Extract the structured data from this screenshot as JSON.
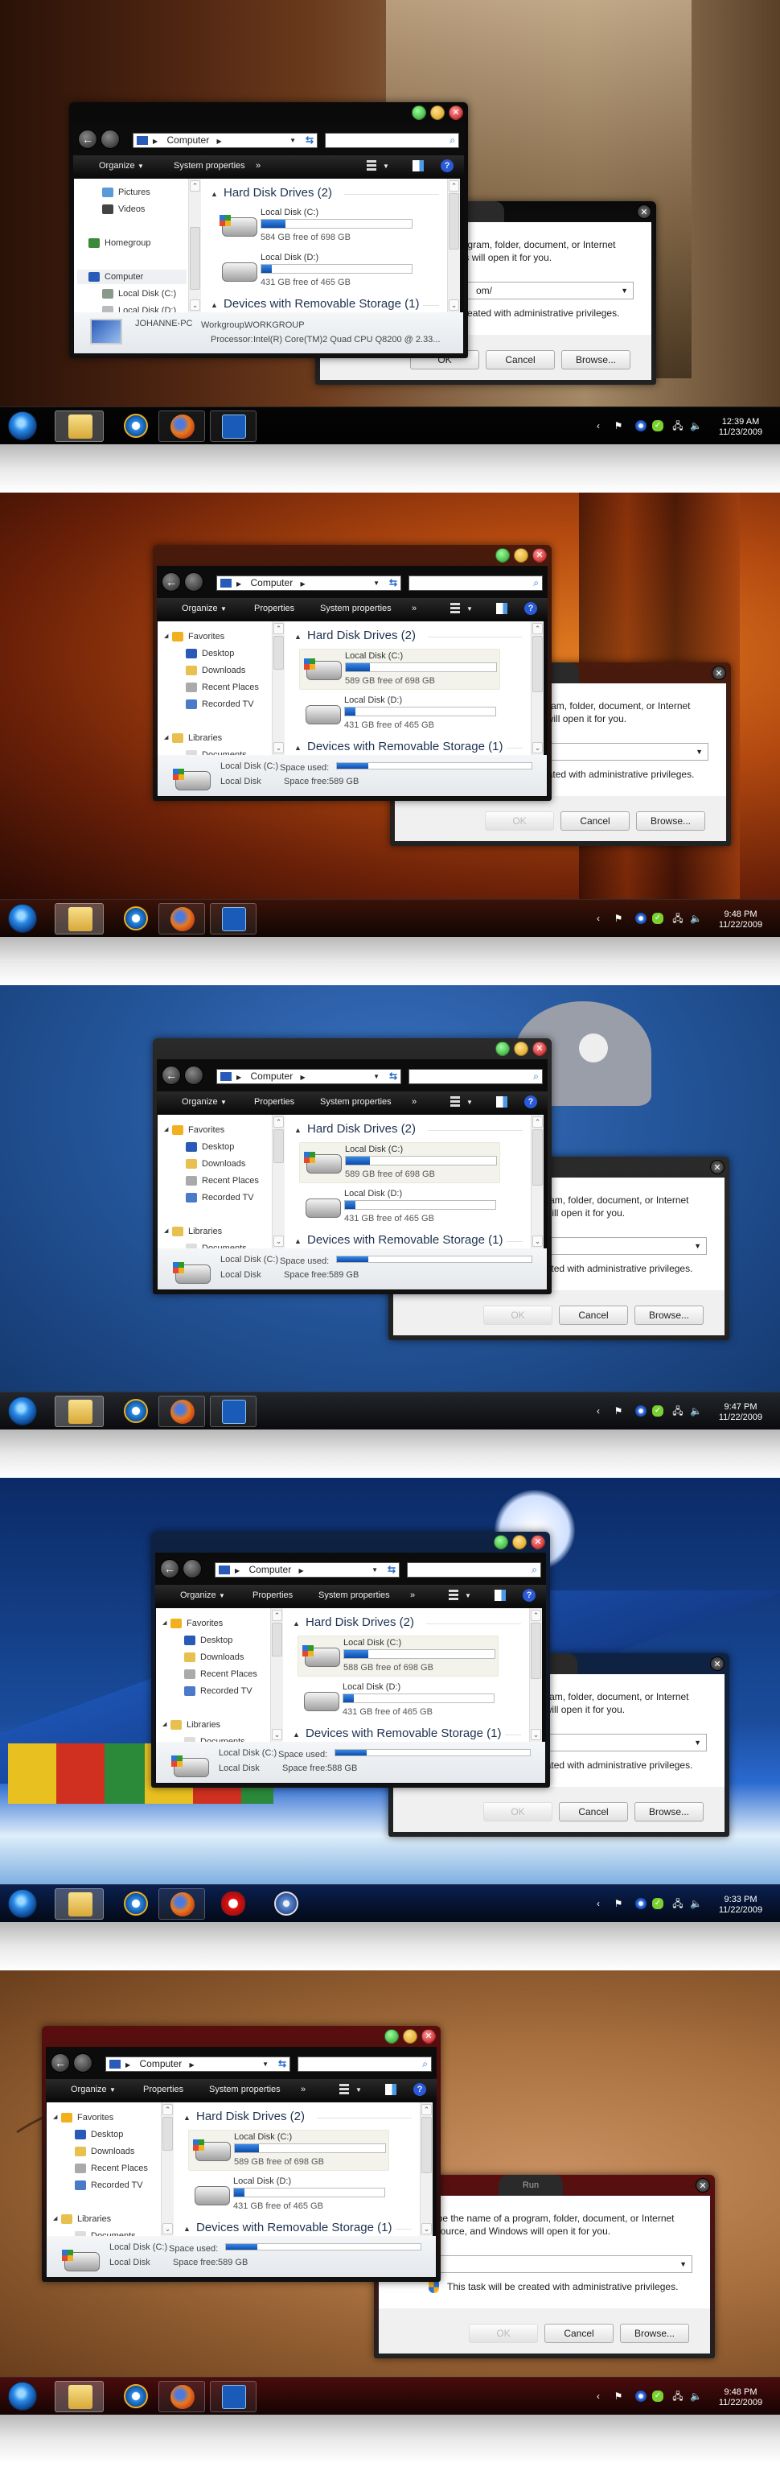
{
  "panels": [
    {
      "theme": {
        "frame": "#0a0a0a",
        "taskbar": "#050505"
      },
      "explorer": {
        "address": "Computer",
        "commands": [
          "Organize",
          "System properties",
          "»"
        ],
        "nav": [
          {
            "label": "Pictures",
            "icon": "pictures-icon",
            "indent": 1
          },
          {
            "label": "Videos",
            "icon": "videos-icon",
            "indent": 1
          },
          {
            "label": "Homegroup",
            "icon": "homegroup-icon",
            "indent": 0
          },
          {
            "label": "Computer",
            "icon": "computer-icon",
            "indent": 0,
            "selected": true
          },
          {
            "label": "Local Disk (C:)",
            "icon": "drive-c-icon",
            "indent": 1
          },
          {
            "label": "Local Disk (D:)",
            "icon": "drive-d-icon",
            "indent": 1
          }
        ],
        "nav_tops": [
          8,
          29,
          71,
          113,
          134,
          155
        ],
        "sections": {
          "hdd": "Hard Disk Drives (2)",
          "removable": "Devices with Removable Storage (1)"
        },
        "drives": [
          {
            "name": "Local Disk (C:)",
            "free": "584 GB free of 698 GB",
            "used_percent": 16,
            "selected": false,
            "system": true
          },
          {
            "name": "Local Disk (D:)",
            "free": "431 GB free of 465 GB",
            "used_percent": 7,
            "selected": false,
            "system": false
          }
        ],
        "details": {
          "type": "computer",
          "name": "JOHANNE-PC",
          "workgroup_label": "Workgroup:",
          "workgroup": "WORKGROUP",
          "processor_label": "Processor:",
          "processor": "Intel(R) Core(TM)2 Quad  CPU   Q8200  @ 2.33..."
        }
      },
      "run": {
        "title": "",
        "description": "Type the name of a program, folder, document, or Internet resource, and Windows will open it for you.",
        "open_value": "om/",
        "admin_note": "This task will be created with administrative privileges.",
        "ok": "OK",
        "cancel": "Cancel",
        "browse": "Browse...",
        "ok_enabled": true
      },
      "taskbar": {
        "apps": [
          "explorer",
          "internet-explorer",
          "firefox",
          "photoshop"
        ],
        "time": "12:39 AM",
        "date": "11/23/2009"
      }
    },
    {
      "theme": {
        "frame": "#4a1a0c",
        "taskbar": "#3a1208"
      },
      "explorer": {
        "address": "Computer",
        "commands": [
          "Organize",
          "Properties",
          "System properties",
          "»"
        ],
        "nav": [
          {
            "label": "Favorites",
            "icon": "star-icon",
            "indent": 0
          },
          {
            "label": "Desktop",
            "icon": "desktop-icon",
            "indent": 1
          },
          {
            "label": "Downloads",
            "icon": "downloads-icon",
            "indent": 1
          },
          {
            "label": "Recent Places",
            "icon": "recent-places-icon",
            "indent": 1
          },
          {
            "label": "Recorded TV",
            "icon": "recorded-tv-icon",
            "indent": 1
          },
          {
            "label": "Libraries",
            "icon": "libraries-icon",
            "indent": 0
          },
          {
            "label": "Documents",
            "icon": "documents-icon",
            "indent": 1
          }
        ],
        "nav_tops": [
          10,
          31,
          52,
          73,
          94,
          136,
          157
        ],
        "sections": {
          "hdd": "Hard Disk Drives (2)",
          "removable": "Devices with Removable Storage (1)"
        },
        "drives": [
          {
            "name": "Local Disk (C:)",
            "free": "589 GB free of 698 GB",
            "used_percent": 16,
            "selected": true,
            "system": true
          },
          {
            "name": "Local Disk (D:)",
            "free": "431 GB free of 465 GB",
            "used_percent": 7,
            "selected": false,
            "system": false
          }
        ],
        "details": {
          "type": "drive",
          "name": "Local Disk (C:)",
          "kind": "Local Disk",
          "used_label": "Space used:",
          "used_percent": 16,
          "free_label": "Space free:",
          "free": "589 GB"
        }
      },
      "run": {
        "title": "",
        "description": "Type the name of a program, folder, document, or Internet resource, and Windows will open it for you.",
        "open_value": "",
        "admin_note": "This task will be created with administrative privileges.",
        "ok": "OK",
        "cancel": "Cancel",
        "browse": "Browse...",
        "ok_enabled": false
      },
      "taskbar": {
        "apps": [
          "explorer",
          "internet-explorer",
          "firefox",
          "photoshop"
        ],
        "time": "9:48 PM",
        "date": "11/22/2009"
      }
    },
    {
      "theme": {
        "frame": "#2a2a2a",
        "taskbar": "#23262c"
      },
      "explorer": {
        "address": "Computer",
        "commands": [
          "Organize",
          "Properties",
          "System properties",
          "»"
        ],
        "nav": [
          {
            "label": "Favorites",
            "icon": "star-icon",
            "indent": 0
          },
          {
            "label": "Desktop",
            "icon": "desktop-icon",
            "indent": 1
          },
          {
            "label": "Downloads",
            "icon": "downloads-icon",
            "indent": 1
          },
          {
            "label": "Recent Places",
            "icon": "recent-places-icon",
            "indent": 1
          },
          {
            "label": "Recorded TV",
            "icon": "recorded-tv-icon",
            "indent": 1
          },
          {
            "label": "Libraries",
            "icon": "libraries-icon",
            "indent": 0
          },
          {
            "label": "Documents",
            "icon": "documents-icon",
            "indent": 1
          }
        ],
        "nav_tops": [
          10,
          31,
          52,
          73,
          94,
          136,
          157
        ],
        "sections": {
          "hdd": "Hard Disk Drives (2)",
          "removable": "Devices with Removable Storage (1)"
        },
        "drives": [
          {
            "name": "Local Disk (C:)",
            "free": "589 GB free of 698 GB",
            "used_percent": 16,
            "selected": true,
            "system": true
          },
          {
            "name": "Local Disk (D:)",
            "free": "431 GB free of 465 GB",
            "used_percent": 7,
            "selected": false,
            "system": false
          }
        ],
        "details": {
          "type": "drive",
          "name": "Local Disk (C:)",
          "kind": "Local Disk",
          "used_label": "Space used:",
          "used_percent": 16,
          "free_label": "Space free:",
          "free": "589 GB"
        }
      },
      "run": {
        "title": "",
        "description": "Type the name of a program, folder, document, or Internet resource, and Windows will open it for you.",
        "open_value": "",
        "admin_note": "This task will be created with administrative privileges.",
        "ok": "OK",
        "cancel": "Cancel",
        "browse": "Browse...",
        "ok_enabled": false
      },
      "taskbar": {
        "apps": [
          "explorer",
          "internet-explorer",
          "firefox",
          "photoshop"
        ],
        "time": "9:47 PM",
        "date": "11/22/2009"
      }
    },
    {
      "theme": {
        "frame": "#0e2244",
        "taskbar": "#0a2050"
      },
      "explorer": {
        "address": "Computer",
        "commands": [
          "Organize",
          "Properties",
          "System properties",
          "»"
        ],
        "nav": [
          {
            "label": "Favorites",
            "icon": "star-icon",
            "indent": 0
          },
          {
            "label": "Desktop",
            "icon": "desktop-icon",
            "indent": 1
          },
          {
            "label": "Downloads",
            "icon": "downloads-icon",
            "indent": 1
          },
          {
            "label": "Recent Places",
            "icon": "recent-places-icon",
            "indent": 1
          },
          {
            "label": "Recorded TV",
            "icon": "recorded-tv-icon",
            "indent": 1
          },
          {
            "label": "Libraries",
            "icon": "libraries-icon",
            "indent": 0
          },
          {
            "label": "Documents",
            "icon": "documents-icon",
            "indent": 1
          }
        ],
        "nav_tops": [
          10,
          31,
          52,
          73,
          94,
          136,
          157
        ],
        "sections": {
          "hdd": "Hard Disk Drives (2)",
          "removable": "Devices with Removable Storage (1)"
        },
        "drives": [
          {
            "name": "Local Disk (C:)",
            "free": "588 GB free of 698 GB",
            "used_percent": 16,
            "selected": true,
            "system": true
          },
          {
            "name": "Local Disk (D:)",
            "free": "431 GB free of 465 GB",
            "used_percent": 7,
            "selected": false,
            "system": false
          }
        ],
        "details": {
          "type": "drive",
          "name": "Local Disk (C:)",
          "kind": "Local Disk",
          "used_label": "Space used:",
          "used_percent": 16,
          "free_label": "Space free:",
          "free": "588 GB"
        }
      },
      "run": {
        "title": "",
        "description": "Type the name of a program, folder, document, or Internet resource, and Windows will open it for you.",
        "open_value": "",
        "admin_note": "This task will be created with administrative privileges.",
        "ok": "OK",
        "cancel": "Cancel",
        "browse": "Browse...",
        "ok_enabled": false
      },
      "taskbar": {
        "apps": [
          "explorer",
          "internet-explorer",
          "firefox",
          "opera",
          "safari"
        ],
        "time": "9:33 PM",
        "date": "11/22/2009"
      }
    },
    {
      "theme": {
        "frame": "#5a0e0e",
        "taskbar": "#4a0c0c"
      },
      "explorer": {
        "address": "Computer",
        "commands": [
          "Organize",
          "Properties",
          "System properties",
          "»"
        ],
        "nav": [
          {
            "label": "Favorites",
            "icon": "star-icon",
            "indent": 0
          },
          {
            "label": "Desktop",
            "icon": "desktop-icon",
            "indent": 1
          },
          {
            "label": "Downloads",
            "icon": "downloads-icon",
            "indent": 1
          },
          {
            "label": "Recent Places",
            "icon": "recent-places-icon",
            "indent": 1
          },
          {
            "label": "Recorded TV",
            "icon": "recorded-tv-icon",
            "indent": 1
          },
          {
            "label": "Libraries",
            "icon": "libraries-icon",
            "indent": 0
          },
          {
            "label": "Documents",
            "icon": "documents-icon",
            "indent": 1
          }
        ],
        "nav_tops": [
          10,
          31,
          52,
          73,
          94,
          136,
          157
        ],
        "sections": {
          "hdd": "Hard Disk Drives (2)",
          "removable": "Devices with Removable Storage (1)"
        },
        "drives": [
          {
            "name": "Local Disk (C:)",
            "free": "589 GB free of 698 GB",
            "used_percent": 16,
            "selected": true,
            "system": true
          },
          {
            "name": "Local Disk (D:)",
            "free": "431 GB free of 465 GB",
            "used_percent": 7,
            "selected": false,
            "system": false
          }
        ],
        "details": {
          "type": "drive",
          "name": "Local Disk (C:)",
          "kind": "Local Disk",
          "used_label": "Space used:",
          "used_percent": 16,
          "free_label": "Space free:",
          "free": "589 GB"
        }
      },
      "run": {
        "title": "Run",
        "description": "Type the name of a program, folder, document, or Internet resource, and Windows will open it for you.",
        "open_value": "",
        "admin_note": "This task will be created with administrative privileges.",
        "ok": "OK",
        "cancel": "Cancel",
        "browse": "Browse...",
        "ok_enabled": false
      },
      "taskbar": {
        "apps": [
          "explorer",
          "internet-explorer",
          "firefox",
          "photoshop"
        ],
        "time": "9:48 PM",
        "date": "11/22/2009"
      }
    }
  ]
}
